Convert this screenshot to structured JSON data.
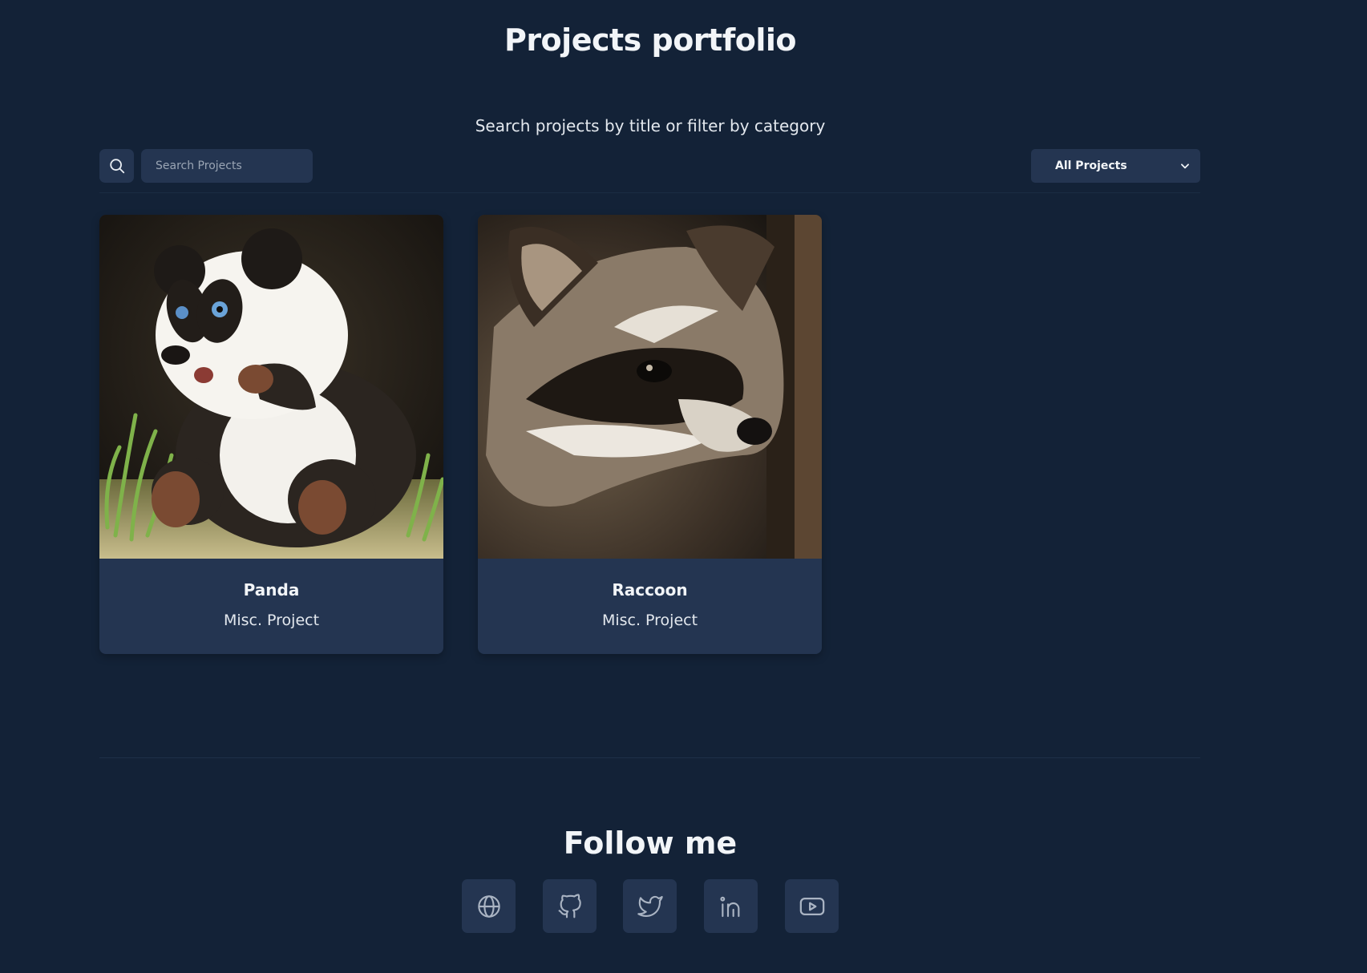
{
  "header": {
    "title": "Projects portfolio"
  },
  "filters": {
    "hint": "Search projects by title or filter by category",
    "search_placeholder": "Search Projects",
    "category_selected": "All Projects"
  },
  "projects": [
    {
      "title": "Panda",
      "category": "Misc. Project"
    },
    {
      "title": "Raccoon",
      "category": "Misc. Project"
    }
  ],
  "footer": {
    "follow_title": "Follow me",
    "socials": [
      "globe-icon",
      "github-icon",
      "twitter-icon",
      "linkedin-icon",
      "youtube-icon"
    ]
  },
  "colors": {
    "background": "#132237",
    "surface": "#243551",
    "text": "#f2f5f8"
  }
}
